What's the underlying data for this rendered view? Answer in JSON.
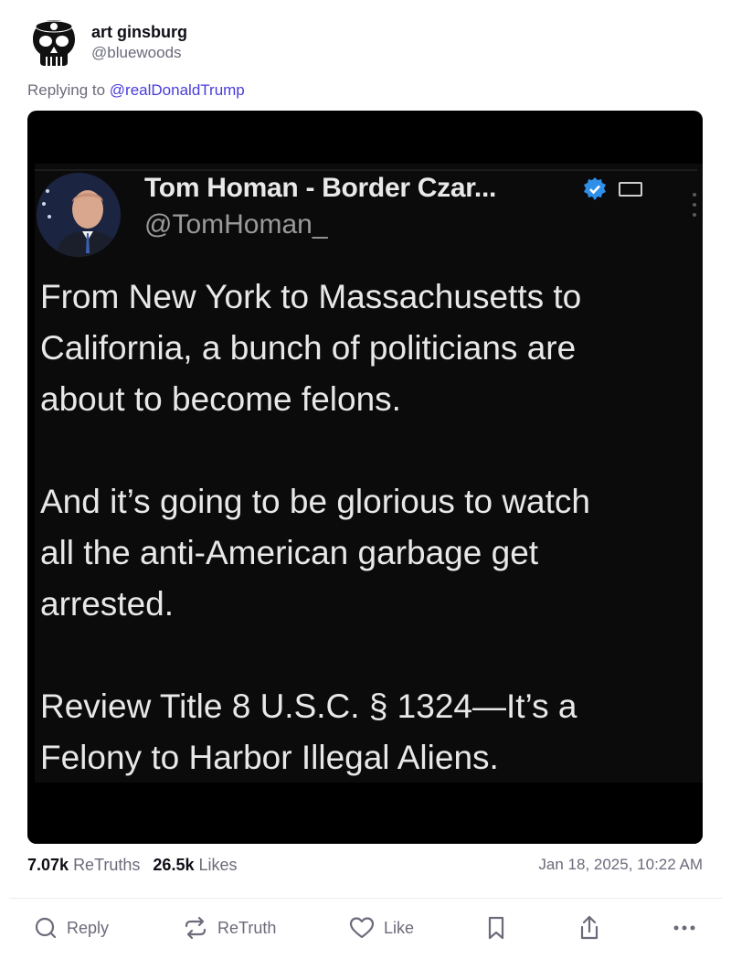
{
  "post": {
    "author": {
      "display_name": "art ginsburg",
      "handle": "@bluewoods",
      "avatar_icon": "skull-emblem-icon"
    },
    "replying_prefix": "Replying to",
    "replying_to": "@realDonaldTrump",
    "media": {
      "tweet": {
        "name": "Tom Homan - Border Czar...",
        "handle": "@TomHoman_",
        "paragraphs": [
          "From New York to Massachusetts to\nCalifornia, a bunch of politicians are\nabout to become felons.",
          "And it’s going to be glorious to watch\nall the anti-American garbage get\narrested.",
          "Review Title 8 U.S.C. § 1324—It’s a\nFelony to Harbor Illegal Aliens."
        ]
      }
    },
    "stats": {
      "retruths_count": "7.07k",
      "retruths_label": "ReTruths",
      "likes_count": "26.5k",
      "likes_label": "Likes"
    },
    "timestamp": "Jan 18, 2025, 10:22 AM"
  },
  "actions": {
    "reply": "Reply",
    "retruth": "ReTruth",
    "like": "Like"
  },
  "colors": {
    "link": "#4a3cd9",
    "muted": "#6b6b7b",
    "text": "#0f0f17",
    "verified": "#1d9bf0"
  }
}
